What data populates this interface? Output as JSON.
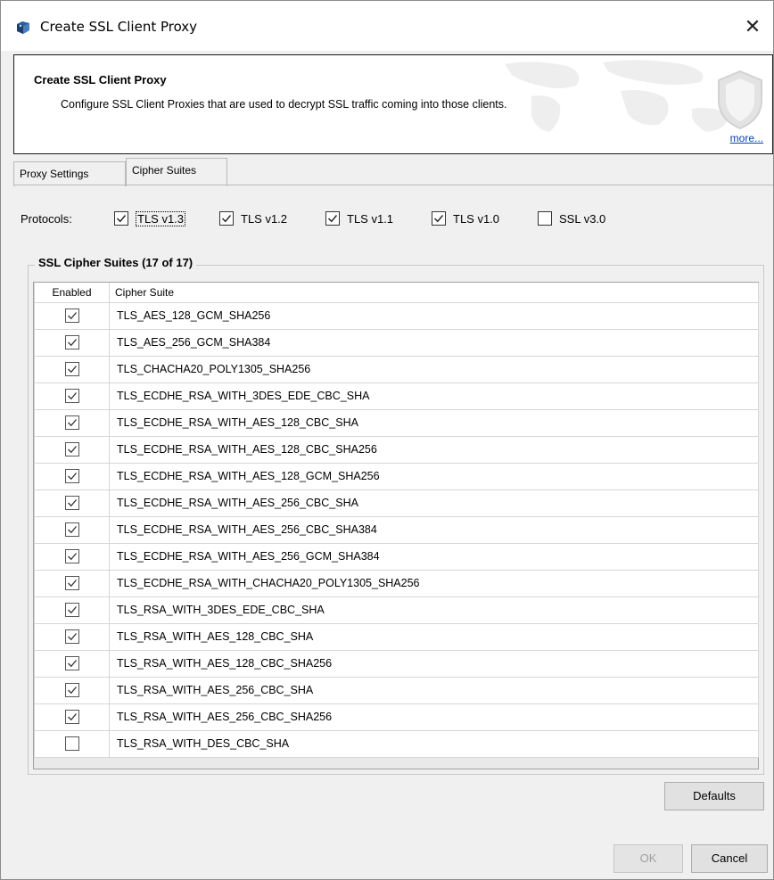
{
  "window": {
    "title": "Create SSL Client Proxy",
    "close_glyph": "✕"
  },
  "banner": {
    "title": "Create SSL Client Proxy",
    "description": "Configure SSL Client Proxies that are used to decrypt SSL traffic coming into those clients.",
    "more_link": "more..."
  },
  "tabs": [
    {
      "label": "Proxy Settings",
      "active": false
    },
    {
      "label": "Cipher Suites",
      "active": true
    }
  ],
  "protocols": {
    "label": "Protocols:",
    "items": [
      {
        "label": "TLS v1.3",
        "checked": true,
        "focused": true
      },
      {
        "label": "TLS v1.2",
        "checked": true
      },
      {
        "label": "TLS v1.1",
        "checked": true
      },
      {
        "label": "TLS v1.0",
        "checked": true
      },
      {
        "label": "SSL v3.0",
        "checked": false
      }
    ]
  },
  "cipher_group": {
    "title": "SSL Cipher Suites (17 of 17)",
    "columns": [
      "Enabled",
      "Cipher Suite"
    ],
    "rows": [
      {
        "enabled": true,
        "name": "TLS_AES_128_GCM_SHA256"
      },
      {
        "enabled": true,
        "name": "TLS_AES_256_GCM_SHA384"
      },
      {
        "enabled": true,
        "name": "TLS_CHACHA20_POLY1305_SHA256"
      },
      {
        "enabled": true,
        "name": "TLS_ECDHE_RSA_WITH_3DES_EDE_CBC_SHA"
      },
      {
        "enabled": true,
        "name": "TLS_ECDHE_RSA_WITH_AES_128_CBC_SHA"
      },
      {
        "enabled": true,
        "name": "TLS_ECDHE_RSA_WITH_AES_128_CBC_SHA256"
      },
      {
        "enabled": true,
        "name": "TLS_ECDHE_RSA_WITH_AES_128_GCM_SHA256"
      },
      {
        "enabled": true,
        "name": "TLS_ECDHE_RSA_WITH_AES_256_CBC_SHA"
      },
      {
        "enabled": true,
        "name": "TLS_ECDHE_RSA_WITH_AES_256_CBC_SHA384"
      },
      {
        "enabled": true,
        "name": "TLS_ECDHE_RSA_WITH_AES_256_GCM_SHA384"
      },
      {
        "enabled": true,
        "name": "TLS_ECDHE_RSA_WITH_CHACHA20_POLY1305_SHA256"
      },
      {
        "enabled": true,
        "name": "TLS_RSA_WITH_3DES_EDE_CBC_SHA"
      },
      {
        "enabled": true,
        "name": "TLS_RSA_WITH_AES_128_CBC_SHA"
      },
      {
        "enabled": true,
        "name": "TLS_RSA_WITH_AES_128_CBC_SHA256"
      },
      {
        "enabled": true,
        "name": "TLS_RSA_WITH_AES_256_CBC_SHA"
      },
      {
        "enabled": true,
        "name": "TLS_RSA_WITH_AES_256_CBC_SHA256"
      },
      {
        "enabled": false,
        "name": "TLS_RSA_WITH_DES_CBC_SHA"
      }
    ]
  },
  "buttons": {
    "defaults": "Defaults",
    "ok": "OK",
    "cancel": "Cancel",
    "ok_enabled": false
  },
  "icons": {
    "app": "app-globe-icon",
    "close": "close-icon",
    "shield": "shield-icon",
    "check": "checkmark-icon"
  },
  "colors": {
    "link": "#0645ad",
    "background": "#f0f0f0",
    "disabled_text": "#a0a0a0"
  }
}
